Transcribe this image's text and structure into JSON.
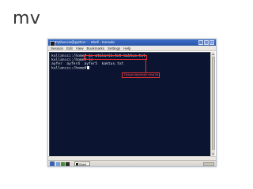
{
  "slide": {
    "title": "mv"
  },
  "window": {
    "title": "Python.txt@python : - Shell - Konsole",
    "controls": [
      "_",
      "□",
      "×"
    ]
  },
  "menubar": {
    "items": [
      "Session",
      "Edit",
      "View",
      "Bookmarks",
      "Settings",
      "Help"
    ]
  },
  "terminal": {
    "lines": [
      {
        "prompt": "kullanıcı:/home#",
        "command": " mv atalarik.txt kaktus.txt"
      },
      {
        "prompt": "kullanıcı:/home#",
        "command": " ls"
      },
      {
        "prompt": "",
        "command": "ayfer  ayfer4  ayfer5  kaktus.txt"
      },
      {
        "prompt": "kullanıcı:/home#",
        "command": ""
      }
    ],
    "annotation": "Dosyaı taşınması veya ila"
  },
  "taskbar": {
    "task_label": "Shell"
  },
  "colors": {
    "titlebar": "#2a55a8",
    "terminal_bg": "#0b1532",
    "terminal_text": "#e6e6e6",
    "highlight": "#e03030",
    "annotation_text": "#ff4b4b"
  },
  "icons": [
    "konsole-icon",
    "start-menu-icon",
    "home-icon",
    "browser-icon",
    "terminal-icon",
    "tray-icon"
  ]
}
